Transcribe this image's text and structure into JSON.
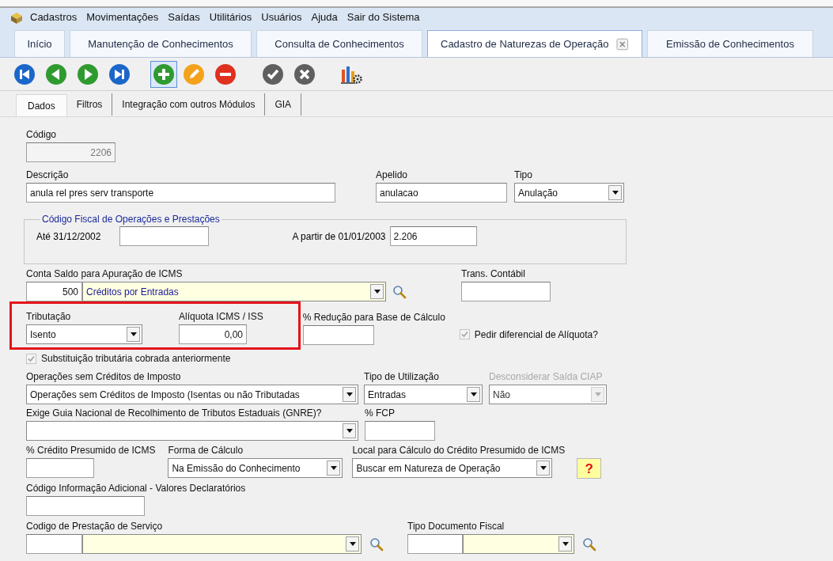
{
  "menu": [
    {
      "label": "Cadastros"
    },
    {
      "label": "Movimentações"
    },
    {
      "label": "Saídas"
    },
    {
      "label": "Utilitários"
    },
    {
      "label": "Usuários"
    },
    {
      "label": "Ajuda"
    },
    {
      "label": "Sair do Sistema"
    }
  ],
  "tabs": [
    {
      "label": "Início",
      "selected": false,
      "closable": false
    },
    {
      "label": "Manutenção de Conhecimentos",
      "selected": false,
      "closable": false
    },
    {
      "label": "Consulta de Conhecimentos",
      "selected": false,
      "closable": false
    },
    {
      "label": "Cadastro de Naturezas de Operação",
      "selected": true,
      "closable": true
    },
    {
      "label": "Emissão de Conhecimentos",
      "selected": false,
      "closable": false
    }
  ],
  "toolbar": [
    {
      "kind": "first",
      "focused": false
    },
    {
      "kind": "prev",
      "focused": false
    },
    {
      "kind": "next",
      "focused": false
    },
    {
      "kind": "last",
      "focused": false
    },
    {
      "kind": "add",
      "focused": true
    },
    {
      "kind": "edit",
      "focused": false
    },
    {
      "kind": "delete",
      "focused": false
    },
    {
      "kind": "confirm",
      "focused": false
    },
    {
      "kind": "cancel",
      "focused": false
    },
    {
      "kind": "report",
      "focused": false
    }
  ],
  "subtabs": [
    {
      "label": "Dados",
      "selected": true
    },
    {
      "label": "Filtros",
      "selected": false
    },
    {
      "label": "Integração com outros Módulos",
      "selected": false
    },
    {
      "label": "GIA",
      "selected": false
    }
  ],
  "form": {
    "codigo": {
      "label": "Código",
      "value": "2206",
      "disabled": true
    },
    "descricao": {
      "label": "Descrição",
      "value": "anula rel pres serv transporte"
    },
    "apelido": {
      "label": "Apelido",
      "value": "anulacao"
    },
    "tipo": {
      "label": "Tipo",
      "value": "Anulação"
    },
    "cfop": {
      "legend": "Código Fiscal de Operações e Prestações",
      "ate": {
        "label": "Até 31/12/2002"
      },
      "a_partir": {
        "label": "A partir de 01/01/2003",
        "value": "2.206"
      }
    },
    "conta_saldo": {
      "label": "Conta Saldo para Apuração de ICMS",
      "code": "500",
      "value": "Créditos por Entradas"
    },
    "trans_contabil": {
      "label": "Trans. Contábil"
    },
    "tax_group": {
      "highlighted": true,
      "tributacao": {
        "label": "Tributação",
        "value": "Isento"
      },
      "aliquota": {
        "label": "Alíquota ICMS / ISS",
        "value": "0,00"
      }
    },
    "reducao": {
      "label": "% Redução para Base de Cálculo"
    },
    "pedir_diferencial": {
      "label": "Pedir diferencial de Alíquota?",
      "checked": true,
      "disabled": true
    },
    "substituicao": {
      "label": "Substituição tributária cobrada anteriormente",
      "checked": true,
      "disabled": true
    },
    "operacoes_sem_creditos": {
      "label": "Operações sem Créditos de Imposto",
      "value": "Operações sem Créditos de Imposto (Isentas ou não Tributadas"
    },
    "tipo_utilizacao": {
      "label": "Tipo de Utilização",
      "value": "Entradas"
    },
    "desconsiderar_ciap": {
      "label": "Desconsiderar Saída CIAP",
      "value": "Não",
      "disabled": true
    },
    "gnre": {
      "label": "Exige Guia Nacional de Recolhimento de Tributos Estaduais (GNRE)?"
    },
    "fcp": {
      "label": "% FCP"
    },
    "credito_presumido": {
      "label": "% Crédito Presumido de ICMS"
    },
    "forma_calculo": {
      "label": "Forma de Cálculo",
      "value": "Na Emissão do Conhecimento"
    },
    "local_calculo": {
      "label": "Local para Cálculo do Crédito Presumido de ICMS",
      "value": "Buscar em Natureza de Operação"
    },
    "help_button": {
      "label": "?"
    },
    "info_adicional": {
      "label": "Código Informação Adicional - Valores Declaratórios"
    },
    "prestacao_servico": {
      "label": "Codigo de Prestação de Serviço"
    },
    "tipo_documento": {
      "label": "Tipo Documento Fiscal"
    }
  }
}
